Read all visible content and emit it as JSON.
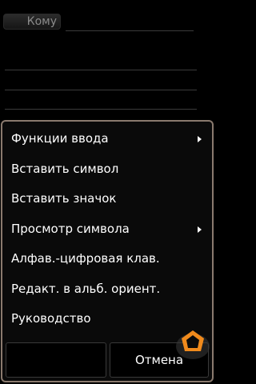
{
  "compose": {
    "to_label": "Кому"
  },
  "menu": {
    "items": [
      {
        "label": "Функции ввода",
        "submenu": true
      },
      {
        "label": "Вставить символ",
        "submenu": false
      },
      {
        "label": "Вставить значок",
        "submenu": false
      },
      {
        "label": "Просмотр символа",
        "submenu": true
      },
      {
        "label": "Алфав.-цифровая клав.",
        "submenu": false
      },
      {
        "label": "Редакт. в альб. ориент.",
        "submenu": false
      },
      {
        "label": "Руководство",
        "submenu": false
      }
    ]
  },
  "softkeys": {
    "left_label": "",
    "right_label": "Отмена"
  },
  "colors": {
    "menu_border": "#8a7a6e",
    "background": "#000000",
    "logo_orange": "#f08a1c"
  }
}
